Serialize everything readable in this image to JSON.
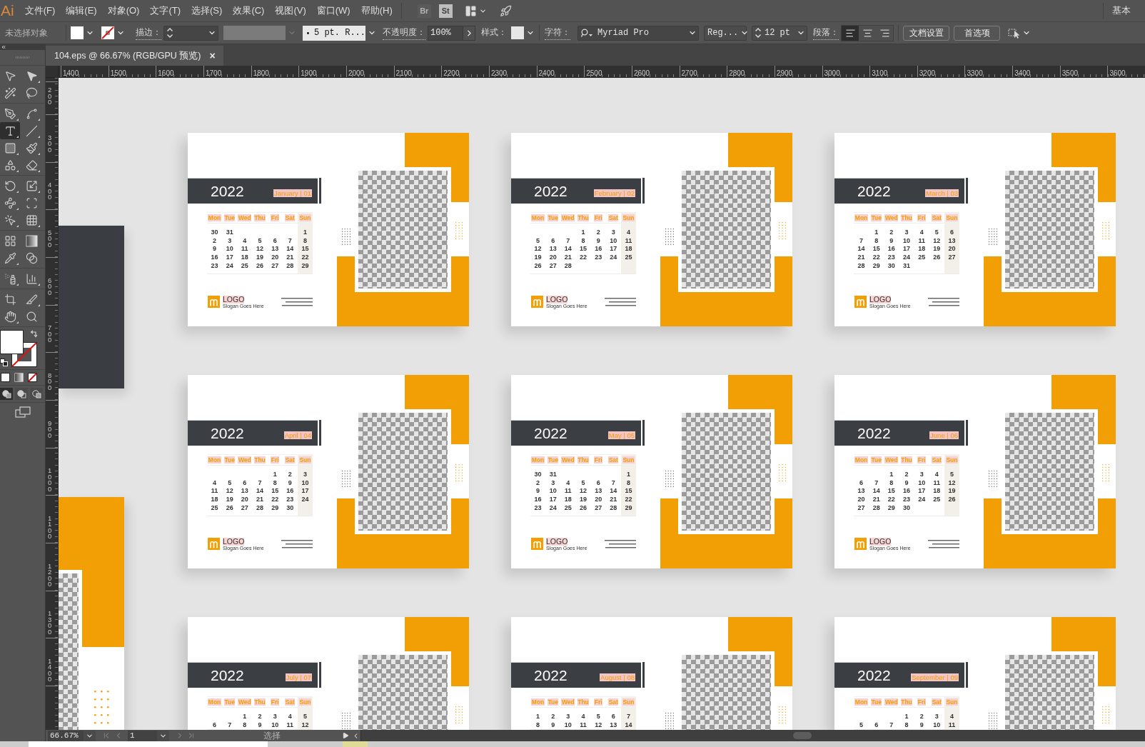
{
  "menu_bar": {
    "logo": "Ai",
    "menus": [
      "文件(F)",
      "编辑(E)",
      "对象(O)",
      "文字(T)",
      "选择(S)",
      "效果(C)",
      "视图(V)",
      "窗口(W)",
      "帮助(H)"
    ],
    "apps": [
      {
        "label": "Br",
        "disabled": true
      },
      {
        "label": "St",
        "disabled": false
      }
    ],
    "workspace": "基本"
  },
  "control_bar": {
    "selection": "未选择对象",
    "stroke_label": "描边：",
    "brush": "5 pt. R...",
    "opacity_label": "不透明度：",
    "opacity": "100%",
    "style_label": "样式：",
    "character_label": "字符：",
    "font": "Myriad Pro",
    "font_style": "Reg...",
    "font_size": "12 pt",
    "paragraph_label": "段落：",
    "alignments": [
      {
        "selected": true
      },
      {
        "selected": false
      },
      {
        "selected": false
      }
    ],
    "buttons": [
      "文档设置",
      "首选项"
    ]
  },
  "document_tab": {
    "title": "104.eps @ 66.67% (RGB/GPU 预览)",
    "close": "×"
  },
  "tools": [
    {
      "selected": false
    },
    {
      "selected": false
    },
    {
      "selected": false
    },
    {
      "selected": false
    },
    {
      "selected": false
    },
    {
      "selected": false
    },
    {
      "selected": true
    },
    {
      "selected": false
    },
    {
      "selected": false
    },
    {
      "selected": false
    },
    {
      "selected": false
    },
    {
      "selected": false
    },
    {
      "selected": false
    },
    {
      "selected": false
    },
    {
      "selected": false
    },
    {
      "selected": false
    },
    {
      "selected": false
    },
    {
      "selected": false
    },
    {
      "selected": false
    },
    {
      "selected": false
    },
    {
      "selected": false
    },
    {
      "selected": false
    },
    {
      "selected": false
    },
    {
      "selected": false
    },
    {
      "selected": false
    },
    {
      "selected": false
    },
    {
      "selected": false
    },
    {
      "selected": false
    }
  ],
  "draw_modes": [
    {
      "selected": true
    },
    {
      "selected": false
    },
    {
      "selected": false
    }
  ],
  "rulers": {
    "horizontal": [
      "1400",
      "1500",
      "1600",
      "1700",
      "1800",
      "1900",
      "2000",
      "2100",
      "2200",
      "2300",
      "2400",
      "2500",
      "2600",
      "2700",
      "2800",
      "2900",
      "3000",
      "3100",
      "3200",
      "3300",
      "3400",
      "3500",
      "3600"
    ],
    "vertical": [
      "200",
      "300",
      "400",
      "500",
      "600",
      "700",
      "800",
      "900",
      "1000",
      "1100",
      "1200",
      "1300",
      "1400"
    ]
  },
  "artboards": [
    {
      "year": "2022",
      "month": "January | 01",
      "weekdays": [
        {
          "label": "Mon",
          "highlighted": false
        },
        {
          "label": "Tue",
          "highlighted": false
        },
        {
          "label": "Wed",
          "highlighted": false
        },
        {
          "label": "Thu",
          "highlighted": false
        },
        {
          "label": "Fri",
          "highlighted": false
        },
        {
          "label": "Sat",
          "highlighted": false
        },
        {
          "label": "Sun",
          "highlighted": true
        }
      ],
      "weeks": [
        {
          "mon": "30",
          "tue": "31",
          "sun": "1"
        },
        {
          "mon": "2",
          "tue": "3",
          "wed": "4",
          "thu": "5",
          "fri": "6",
          "sat": "7",
          "sun": "8"
        },
        {
          "mon": "9",
          "tue": "10",
          "wed": "11",
          "thu": "12",
          "fri": "13",
          "sat": "14",
          "sun": "15"
        },
        {
          "mon": "16",
          "tue": "17",
          "wed": "18",
          "thu": "19",
          "fri": "20",
          "sat": "21",
          "sun": "22"
        },
        {
          "mon": "23",
          "tue": "24",
          "wed": "25",
          "thu": "26",
          "fri": "27",
          "sat": "28",
          "sun": "29"
        }
      ],
      "logo": "LOGO",
      "slogan": "Slogan Goes Here"
    },
    {
      "year": "2022",
      "month": "February | 02",
      "weekdays": [
        {
          "label": "Mon",
          "highlighted": false
        },
        {
          "label": "Tue",
          "highlighted": false
        },
        {
          "label": "Wed",
          "highlighted": false
        },
        {
          "label": "Thu",
          "highlighted": false
        },
        {
          "label": "Fri",
          "highlighted": false
        },
        {
          "label": "Sat",
          "highlighted": false
        },
        {
          "label": "Sun",
          "highlighted": true
        }
      ],
      "weeks": [
        {
          "thu": "1",
          "fri": "2",
          "sat": "3",
          "sun": "4"
        },
        {
          "mon": "5",
          "tue": "6",
          "wed": "7",
          "thu": "8",
          "fri": "9",
          "sat": "10",
          "sun": "11"
        },
        {
          "mon": "12",
          "tue": "13",
          "wed": "14",
          "thu": "15",
          "fri": "16",
          "sat": "17",
          "sun": "18"
        },
        {
          "mon": "19",
          "tue": "20",
          "wed": "21",
          "thu": "22",
          "fri": "23",
          "sat": "24",
          "sun": "25"
        },
        {
          "mon": "26",
          "tue": "27",
          "wed": "28"
        }
      ],
      "logo": "LOGO",
      "slogan": "Slogan Goes Here"
    },
    {
      "year": "2022",
      "month": "March | 03",
      "weekdays": [
        {
          "label": "Mon",
          "highlighted": false
        },
        {
          "label": "Tue",
          "highlighted": false
        },
        {
          "label": "Wed",
          "highlighted": false
        },
        {
          "label": "Thu",
          "highlighted": false
        },
        {
          "label": "Fri",
          "highlighted": false
        },
        {
          "label": "Sat",
          "highlighted": false
        },
        {
          "label": "Sun",
          "highlighted": true
        }
      ],
      "weeks": [
        {
          "tue": "1",
          "wed": "2",
          "thu": "3",
          "fri": "4",
          "sat": "5",
          "sun": "6"
        },
        {
          "mon": "7",
          "tue": "8",
          "wed": "9",
          "thu": "10",
          "fri": "11",
          "sat": "12",
          "sun": "13"
        },
        {
          "mon": "14",
          "tue": "15",
          "wed": "16",
          "thu": "17",
          "fri": "18",
          "sat": "19",
          "sun": "20"
        },
        {
          "mon": "21",
          "tue": "22",
          "wed": "23",
          "thu": "24",
          "fri": "25",
          "sat": "26",
          "sun": "27"
        },
        {
          "mon": "28",
          "tue": "29",
          "wed": "30",
          "thu": "31"
        }
      ],
      "logo": "LOGO",
      "slogan": "Slogan Goes Here"
    },
    {
      "year": "2022",
      "month": "April | 04",
      "weekdays": [
        {
          "label": "Mon",
          "highlighted": false
        },
        {
          "label": "Tue",
          "highlighted": false
        },
        {
          "label": "Wed",
          "highlighted": false
        },
        {
          "label": "Thu",
          "highlighted": false
        },
        {
          "label": "Fri",
          "highlighted": false
        },
        {
          "label": "Sat",
          "highlighted": false
        },
        {
          "label": "Sun",
          "highlighted": true
        }
      ],
      "weeks": [
        {
          "fri": "1",
          "sat": "2",
          "sun": "3"
        },
        {
          "mon": "4",
          "tue": "5",
          "wed": "6",
          "thu": "7",
          "fri": "8",
          "sat": "9",
          "sun": "10"
        },
        {
          "mon": "11",
          "tue": "12",
          "wed": "13",
          "thu": "14",
          "fri": "15",
          "sat": "16",
          "sun": "17"
        },
        {
          "mon": "18",
          "tue": "19",
          "wed": "20",
          "thu": "21",
          "fri": "22",
          "sat": "23",
          "sun": "24"
        },
        {
          "mon": "25",
          "tue": "26",
          "wed": "27",
          "thu": "28",
          "fri": "29",
          "sat": "30"
        }
      ],
      "logo": "LOGO",
      "slogan": "Slogan Goes Here"
    },
    {
      "year": "2022",
      "month": "May | 05",
      "weekdays": [
        {
          "label": "Mon",
          "highlighted": false
        },
        {
          "label": "Tue",
          "highlighted": false
        },
        {
          "label": "Wed",
          "highlighted": false
        },
        {
          "label": "Thu",
          "highlighted": false
        },
        {
          "label": "Fri",
          "highlighted": false
        },
        {
          "label": "Sat",
          "highlighted": false
        },
        {
          "label": "Sun",
          "highlighted": true
        }
      ],
      "weeks": [
        {
          "mon": "30",
          "tue": "31",
          "sun": "1"
        },
        {
          "mon": "2",
          "tue": "3",
          "wed": "4",
          "thu": "5",
          "fri": "6",
          "sat": "7",
          "sun": "8"
        },
        {
          "mon": "9",
          "tue": "10",
          "wed": "11",
          "thu": "12",
          "fri": "13",
          "sat": "14",
          "sun": "15"
        },
        {
          "mon": "16",
          "tue": "17",
          "wed": "18",
          "thu": "19",
          "fri": "20",
          "sat": "21",
          "sun": "22"
        },
        {
          "mon": "23",
          "tue": "24",
          "wed": "25",
          "thu": "26",
          "fri": "27",
          "sat": "28",
          "sun": "29"
        }
      ],
      "logo": "LOGO",
      "slogan": "Slogan Goes Here"
    },
    {
      "year": "2022",
      "month": "June | 06",
      "weekdays": [
        {
          "label": "Mon",
          "highlighted": false
        },
        {
          "label": "Tue",
          "highlighted": false
        },
        {
          "label": "Wed",
          "highlighted": false
        },
        {
          "label": "Thu",
          "highlighted": false
        },
        {
          "label": "Fri",
          "highlighted": false
        },
        {
          "label": "Sat",
          "highlighted": false
        },
        {
          "label": "Sun",
          "highlighted": true
        }
      ],
      "weeks": [
        {
          "wed": "1",
          "thu": "2",
          "fri": "3",
          "sat": "4",
          "sun": "5"
        },
        {
          "mon": "6",
          "tue": "7",
          "wed": "8",
          "thu": "9",
          "fri": "10",
          "sat": "11",
          "sun": "12"
        },
        {
          "mon": "13",
          "tue": "14",
          "wed": "15",
          "thu": "16",
          "fri": "17",
          "sat": "18",
          "sun": "19"
        },
        {
          "mon": "20",
          "tue": "21",
          "wed": "22",
          "thu": "23",
          "fri": "24",
          "sat": "25",
          "sun": "26"
        },
        {
          "mon": "27",
          "tue": "28",
          "wed": "29",
          "thu": "30"
        }
      ],
      "logo": "LOGO",
      "slogan": "Slogan Goes Here"
    },
    {
      "year": "2022",
      "month": "July | 07",
      "weekdays": [
        {
          "label": "Mon",
          "highlighted": false
        },
        {
          "label": "Tue",
          "highlighted": false
        },
        {
          "label": "Wed",
          "highlighted": false
        },
        {
          "label": "Thu",
          "highlighted": false
        },
        {
          "label": "Fri",
          "highlighted": false
        },
        {
          "label": "Sat",
          "highlighted": false
        },
        {
          "label": "Sun",
          "highlighted": true
        }
      ],
      "weeks": [
        {
          "wed": "1",
          "thu": "2",
          "fri": "3",
          "sat": "4",
          "sun": "5"
        },
        {
          "mon": "6",
          "tue": "7",
          "wed": "8",
          "thu": "9",
          "fri": "10",
          "sat": "11",
          "sun": "12"
        }
      ]
    },
    {
      "year": "2022",
      "month": "August | 08",
      "weekdays": [
        {
          "label": "Mon",
          "highlighted": false
        },
        {
          "label": "Tue",
          "highlighted": false
        },
        {
          "label": "Wed",
          "highlighted": false
        },
        {
          "label": "Thu",
          "highlighted": false
        },
        {
          "label": "Fri",
          "highlighted": false
        },
        {
          "label": "Sat",
          "highlighted": false
        },
        {
          "label": "Sun",
          "highlighted": true
        }
      ],
      "weeks": [
        {
          "mon": "1",
          "tue": "2",
          "wed": "3",
          "thu": "4",
          "fri": "5",
          "sat": "6",
          "sun": "7"
        },
        {
          "mon": "8",
          "tue": "9",
          "wed": "10",
          "thu": "11",
          "fri": "12",
          "sat": "13",
          "sun": "14"
        }
      ]
    },
    {
      "year": "2022",
      "month": "September | 09",
      "weekdays": [
        {
          "label": "Mon",
          "highlighted": false
        },
        {
          "label": "Tue",
          "highlighted": false
        },
        {
          "label": "Wed",
          "highlighted": false
        },
        {
          "label": "Thu",
          "highlighted": false
        },
        {
          "label": "Fri",
          "highlighted": false
        },
        {
          "label": "Sat",
          "highlighted": false
        },
        {
          "label": "Sun",
          "highlighted": true
        }
      ],
      "weeks": [
        {
          "thu": "1",
          "fri": "2",
          "sat": "3",
          "sun": "4"
        },
        {
          "mon": "5",
          "tue": "6",
          "wed": "7",
          "thu": "8",
          "fri": "9",
          "sat": "10",
          "sun": "11"
        }
      ]
    }
  ],
  "status_bar": {
    "zoom": "66.67%",
    "navigation": [
      {
        "disabled": true
      },
      {
        "disabled": true
      },
      {
        "disabled": true
      },
      {
        "disabled": true
      }
    ],
    "artboard": "1",
    "tool": "选择"
  }
}
